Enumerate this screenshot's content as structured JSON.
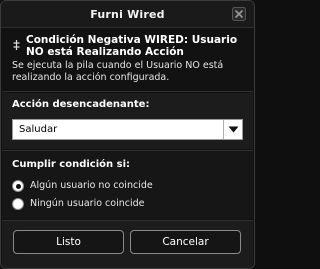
{
  "window": {
    "title": "Furni Wired",
    "close_icon": "close-x-icon"
  },
  "header": {
    "drag_icon": "grip-icon",
    "condition_title": "Condición Negativa WIRED: Usuario NO está Realizando Acción",
    "description": "Se ejecuta la pila cuando el Usuario NO está realizando la acción configurada."
  },
  "trigger": {
    "label": "Acción desencadenante:",
    "selected": "Saludar",
    "arrow_icon": "chevron-down-icon"
  },
  "condition": {
    "label": "Cumplir condición si:",
    "options": [
      {
        "label": "Algún usuario no coincide",
        "checked": true
      },
      {
        "label": "Ningún usuario coincide",
        "checked": false
      }
    ]
  },
  "buttons": {
    "ok_label": "Listo",
    "cancel_label": "Cancelar"
  },
  "colors": {
    "background": "#111111",
    "panel": "#1c1c1c",
    "border": "#8a8a8a",
    "text": "#ffffff"
  }
}
